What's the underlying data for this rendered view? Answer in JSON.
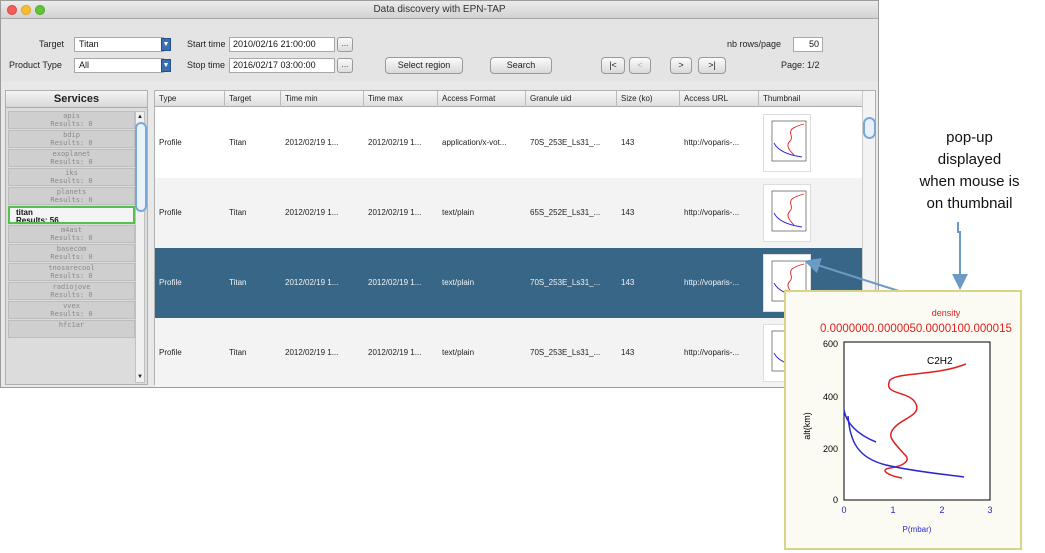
{
  "window": {
    "title": "Data discovery with EPN-TAP"
  },
  "toolbar": {
    "target_label": "Target",
    "target_value": "Titan",
    "product_type_label": "Product Type",
    "product_type_value": "All",
    "start_time_label": "Start time",
    "start_time_value": "2010/02/16 21:00:00",
    "stop_time_label": "Stop time",
    "stop_time_value": "2016/02/17 03:00:00",
    "ellipsis": "...",
    "select_region": "Select region",
    "search": "Search",
    "nav_first": "|<",
    "nav_prev": "<",
    "nav_next": ">",
    "nav_last": ">|",
    "nb_rows_label": "nb rows/page",
    "nb_rows_value": "50",
    "page_label": "Page: 1/2"
  },
  "services": {
    "title": "Services",
    "items": [
      {
        "name": "apis",
        "results": "Results: 0"
      },
      {
        "name": "bdip",
        "results": "Results: 0"
      },
      {
        "name": "exoplanet",
        "results": "Results: 0"
      },
      {
        "name": "iks",
        "results": "Results: 0"
      },
      {
        "name": "planets",
        "results": "Results: 0"
      },
      {
        "name": "titan",
        "results": "Results: 56",
        "selected": true
      },
      {
        "name": "m4ast",
        "results": "Results: 0"
      },
      {
        "name": "basecom",
        "results": "Results: 0"
      },
      {
        "name": "tnosarecool",
        "results": "Results: 0"
      },
      {
        "name": "radiojove",
        "results": "Results: 0"
      },
      {
        "name": "vvex",
        "results": "Results: 0"
      },
      {
        "name": "hfc1ar",
        "results": ""
      }
    ]
  },
  "table": {
    "columns": [
      "Type",
      "Target",
      "Time min",
      "Time max",
      "Access Format",
      "Granule uid",
      "Size (ko)",
      "Access URL",
      "Thumbnail"
    ],
    "rows": [
      [
        "Profile",
        "Titan",
        "2012/02/19 1...",
        "2012/02/19 1...",
        "application/x-vot...",
        "70S_253E_Ls31_...",
        "143",
        "http://voparis-..."
      ],
      [
        "Profile",
        "Titan",
        "2012/02/19 1...",
        "2012/02/19 1...",
        "text/plain",
        "65S_252E_Ls31_...",
        "143",
        "http://voparis-..."
      ],
      [
        "Profile",
        "Titan",
        "2012/02/19 1...",
        "2012/02/19 1...",
        "text/plain",
        "70S_253E_Ls31_...",
        "143",
        "http://voparis-..."
      ],
      [
        "Profile",
        "Titan",
        "2012/02/19 1...",
        "2012/02/19 1...",
        "text/plain",
        "70S_253E_Ls31_...",
        "143",
        "http://voparis-..."
      ]
    ]
  },
  "annotation": {
    "lines": [
      "pop-up",
      "displayed",
      "when mouse is",
      "on thumbnail"
    ]
  },
  "popup": {
    "title": "density",
    "top_ticks": "0.0000000.0000050.0000100.000015",
    "series_label": "C2H2",
    "y_label": "alt(km)",
    "x_label": "P(mbar)",
    "y_ticks": [
      "600",
      "400",
      "200",
      "0"
    ],
    "x_ticks": [
      "0",
      "1",
      "2",
      "3"
    ]
  },
  "colors": {
    "selected_row": "#386686",
    "highlight_border": "#55c04f",
    "arrow": "#6b9ac4",
    "curve_red": "#e02020",
    "curve_blue": "#2828d0"
  }
}
